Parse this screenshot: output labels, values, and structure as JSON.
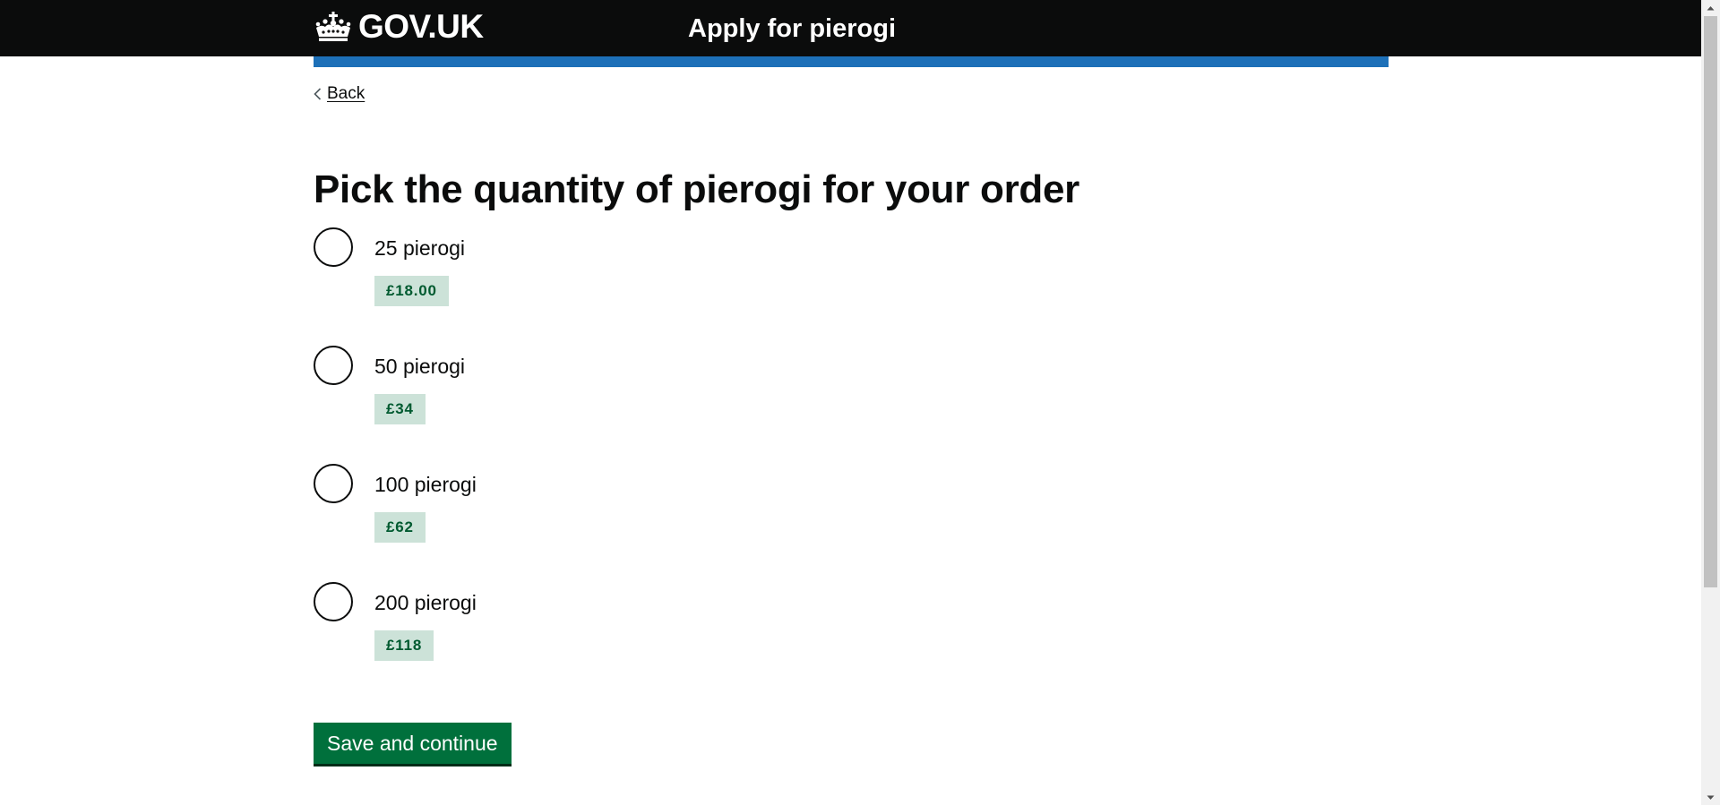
{
  "header": {
    "logo_text": "GOV.UK",
    "service_name": "Apply for pierogi"
  },
  "back_link": {
    "label": "Back"
  },
  "page": {
    "title": "Pick the quantity of pierogi for your order"
  },
  "options": [
    {
      "label": "25 pierogi",
      "price": "£18.00"
    },
    {
      "label": "50 pierogi",
      "price": "£34"
    },
    {
      "label": "100 pierogi",
      "price": "£62"
    },
    {
      "label": "200 pierogi",
      "price": "£118"
    }
  ],
  "actions": {
    "save_label": "Save and continue"
  },
  "colors": {
    "header_bg": "#0b0c0c",
    "accent_blue": "#1d70b8",
    "button_green": "#00703c",
    "tag_bg": "#cce2d8",
    "tag_text": "#005a30"
  },
  "icons": {
    "logo": "crown-icon",
    "back": "chevron-left-icon",
    "scroll_up": "arrow-up-icon",
    "scroll_down": "arrow-down-icon"
  }
}
